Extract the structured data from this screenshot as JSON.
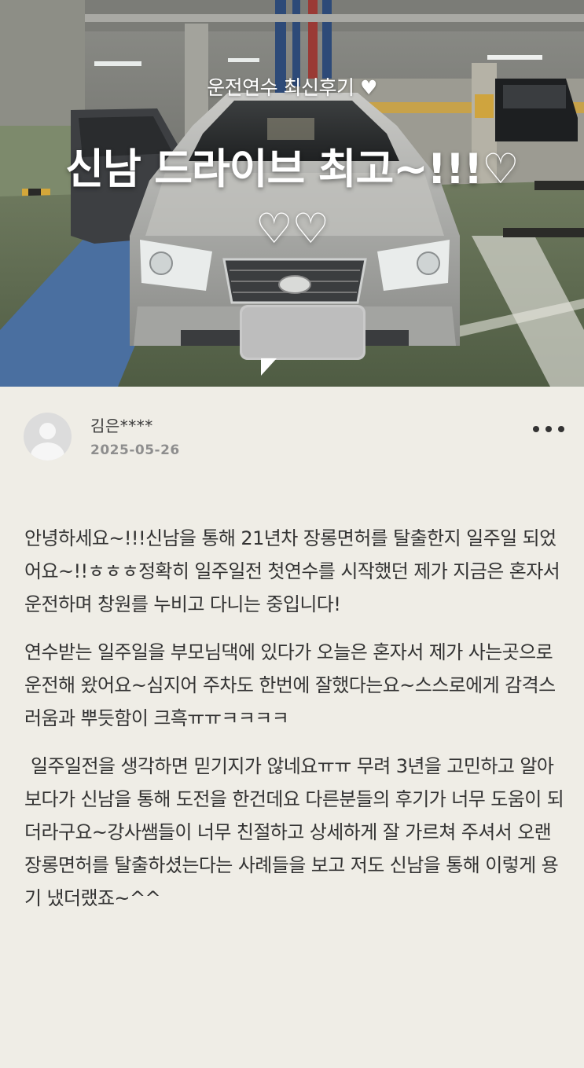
{
  "hero": {
    "subtitle": "운전연수 최신후기 ♥",
    "headline": "신남 드라이브 최고~!!!♡ ♡♡",
    "image": "car-parked-in-underground-garage"
  },
  "author": {
    "name": "김은****",
    "date": "2025-05-26"
  },
  "icons": {
    "more": "more-dots-icon",
    "avatar": "default-profile-icon"
  },
  "post": {
    "paragraphs": [
      "안녕하세요~!!!신남을 통해 21년차 장롱면허를 탈출한지 일주일 되었어요~!!ㅎㅎㅎ정확히 일주일전 첫연수를 시작했던 제가 지금은 혼자서 운전하며 창원를 누비고 다니는 중입니다!",
      "연수받는 일주일을 부모님댁에 있다가 오늘은 혼자서 제가 사는곳으로 운전해 왔어요~심지어 주차도 한번에 잘했다는요~스스로에게 감격스러움과 뿌듯함이 크흑ㅠㅠㅋㅋㅋㅋ",
      "일주일전을 생각하면 믿기지가 않네요ㅠㅠ 무려 3년을 고민하고 알아보다가 신남을 통해 도전을 한건데요 다른분들의 후기가 너무 도움이 되더라구요~강사쌤들이 너무 친절하고 상세하게 잘 가르쳐 주셔서 오랜 장롱면허를 탈출하셨는다는 사례들을 보고 저도 신남을 통해 이렇게 용기 냈더랬죠~^^"
    ]
  }
}
